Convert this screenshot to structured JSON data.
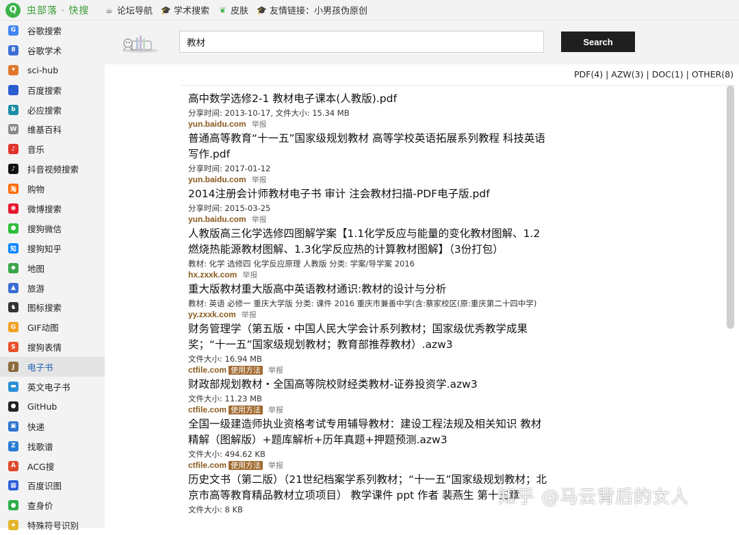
{
  "app": {
    "logo_letter": "Q",
    "logo_text": "虫部落 · 快搜"
  },
  "topnav": [
    {
      "label": "论坛导航",
      "icon": "cup-icon"
    },
    {
      "label": "学术搜索",
      "icon": "mortarboard-icon"
    },
    {
      "label": "皮肤",
      "icon": "leaf-icon"
    },
    {
      "label": "友情链接：小男孩伪原创",
      "icon": "mortarboard-icon"
    }
  ],
  "sidebar": {
    "active_index": 18,
    "items": [
      {
        "label": "谷歌搜索",
        "glyph": "G",
        "color": "#4285f4"
      },
      {
        "label": "谷歌学术",
        "glyph": "8",
        "color": "#3b6fd6"
      },
      {
        "label": "sci-hub",
        "glyph": "✦",
        "color": "#e0772b"
      },
      {
        "label": "百度搜索",
        "glyph": "🐾",
        "color": "#2f5bd3"
      },
      {
        "label": "必应搜索",
        "glyph": "b",
        "color": "#1b8ca3"
      },
      {
        "label": "维基百科",
        "glyph": "W",
        "color": "#8a8a8a"
      },
      {
        "label": "音乐",
        "glyph": "♪",
        "color": "#e0342d"
      },
      {
        "label": "抖音视频搜索",
        "glyph": "♪",
        "color": "#111111"
      },
      {
        "label": "购物",
        "glyph": "淘",
        "color": "#ff6a00"
      },
      {
        "label": "微博搜索",
        "glyph": "◉",
        "color": "#e6162d"
      },
      {
        "label": "搜狗微信",
        "glyph": "●",
        "color": "#2dbd3a"
      },
      {
        "label": "搜狗知乎",
        "glyph": "知",
        "color": "#0a84ff"
      },
      {
        "label": "地图",
        "glyph": "◆",
        "color": "#3aa64a"
      },
      {
        "label": "旅游",
        "glyph": "▲",
        "color": "#3a6ed1"
      },
      {
        "label": "图标搜索",
        "glyph": "♞",
        "color": "#333333"
      },
      {
        "label": "GIF动图",
        "glyph": "G",
        "color": "#f0a020"
      },
      {
        "label": "搜狗表情",
        "glyph": "S",
        "color": "#e8502b"
      },
      {
        "label": "电子书",
        "glyph": "J",
        "color": "#8c6a3c"
      },
      {
        "label": "英文电子书",
        "glyph": "▬",
        "color": "#2b8fd6"
      },
      {
        "label": "GitHub",
        "glyph": "●",
        "color": "#222222"
      },
      {
        "label": "快递",
        "glyph": "▣",
        "color": "#2f74d0"
      },
      {
        "label": "找歌谱",
        "glyph": "Z",
        "color": "#2a7bd6"
      },
      {
        "label": "ACG搜",
        "glyph": "A",
        "color": "#e04a2a"
      },
      {
        "label": "百度识图",
        "glyph": "▦",
        "color": "#3060d8"
      },
      {
        "label": "查身价",
        "glyph": "●",
        "color": "#2fae4b"
      },
      {
        "label": "特殊符号识别",
        "glyph": "★",
        "color": "#e4b62a"
      }
    ]
  },
  "search": {
    "value": "教材",
    "button_label": "Search"
  },
  "filters": [
    {
      "label": "PDF(4)"
    },
    {
      "label": "AZW(3)"
    },
    {
      "label": "DOC(1)"
    },
    {
      "label": "OTHER(8)"
    }
  ],
  "results": [
    {
      "title": "高中数学选修2-1 教材电子课本(人教版).pdf",
      "meta": "分享时间: 2013-10-17, 文件大小: 15.34 MB",
      "domain": "yun.baidu.com",
      "howto": "",
      "report": "举报"
    },
    {
      "title": "普通高等教育“十一五”国家级规划教材 高等学校英语拓展系列教程 科技英语写作.pdf",
      "meta": "分享时间: 2017-01-12",
      "domain": "yun.baidu.com",
      "howto": "",
      "report": "举报"
    },
    {
      "title": "2014注册会计师教材电子书 审计 注会教材扫描-PDF电子版.pdf",
      "meta": "分享时间: 2015-03-25",
      "domain": "yun.baidu.com",
      "howto": "",
      "report": "举报"
    },
    {
      "title": "人教版高三化学选修四图解学案【1.1化学反应与能量的变化教材图解、1.2燃烧热能源教材图解、1.3化学反应热的计算教材图解】（3份打包）",
      "meta": "教材: 化学 选修四 化学反应原理 人教版 分类: 学案/导学案 2016",
      "domain": "hx.zxxk.com",
      "howto": "",
      "report": "举报"
    },
    {
      "title": "重大版教材重大版高中英语教材通识:教材的设计与分析",
      "meta": "教材: 英语 必修一 重庆大学版 分类: 课件 2016 重庆市兼善中学(含:蔡家校区(原:重庆第二十四中学)",
      "domain": "yy.zxxk.com",
      "howto": "",
      "report": "举报"
    },
    {
      "title": "财务管理学（第五版・中国人民大学会计系列教材；国家级优秀教学成果奖；“十一五”国家级规划教材；教育部推荐教材）.azw3",
      "meta": "文件大小: 16.94 MB",
      "domain": "ctfile.com",
      "howto": "使用方法",
      "report": "举报"
    },
    {
      "title": "财政部规划教材・全国高等院校财经类教材-证券投资学.azw3",
      "meta": "文件大小: 11.23 MB",
      "domain": "ctfile.com",
      "howto": "使用方法",
      "report": "举报"
    },
    {
      "title": "全国一级建造师执业资格考试专用辅导教材：建设工程法规及相关知识 教材精解（图解版）+题库解析+历年真题+押题预测.azw3",
      "meta": "文件大小: 494.62 KB",
      "domain": "ctfile.com",
      "howto": "使用方法",
      "report": "举报"
    },
    {
      "title": "历史文书（第二版）（21世纪档案学系列教材；“十一五”国家级规划教材；北京市高等教育精品教材立项项目） 教学课件 ppt 作者 裴燕生 第十三章",
      "meta": "文件大小: 8 KB",
      "domain": "ctfile.com",
      "howto": "",
      "report": ""
    }
  ],
  "watermark": "知乎 @马云背后的女人"
}
